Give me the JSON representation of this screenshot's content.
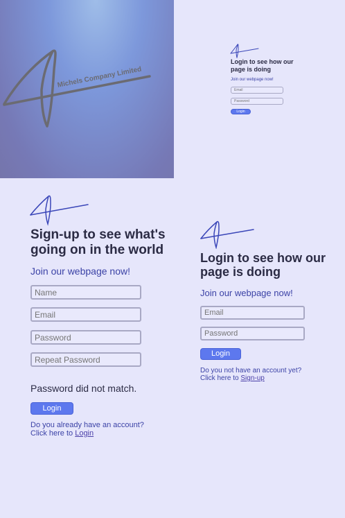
{
  "hero": {
    "company_name": "Michels Company Limited"
  },
  "mini_login": {
    "title": "Login to see how our page is doing",
    "subtitle": "Join our webpage now!",
    "email_placeholder": "Email",
    "password_placeholder": "Password",
    "login_label": "Login"
  },
  "signup": {
    "title": "Sign-up to see what's going on in the world",
    "subtitle": "Join our webpage now!",
    "name_placeholder": "Name",
    "email_placeholder": "Email",
    "password_placeholder": "Password",
    "repeat_password_placeholder": "Repeat Password",
    "error_message": "Password did not match.",
    "login_button_label": "Login",
    "account_question": "Do you already have an account?",
    "click_here": "Click here to",
    "login_link": "Login"
  },
  "login": {
    "title": "Login to see how our page is doing",
    "subtitle": "Join our webpage now!",
    "email_placeholder": "Email",
    "password_placeholder": "Password",
    "login_button_label": "Login",
    "account_question": "Do you not have an account yet?",
    "click_here": "Click here to",
    "signup_link": "Sign-up"
  },
  "colors": {
    "background": "#e6e6fb",
    "accent": "#5d78ee",
    "subtitle": "#3b42a6",
    "logo_stroke": "#3a46b8"
  },
  "icons": {
    "logo": "signature-logo-icon"
  }
}
